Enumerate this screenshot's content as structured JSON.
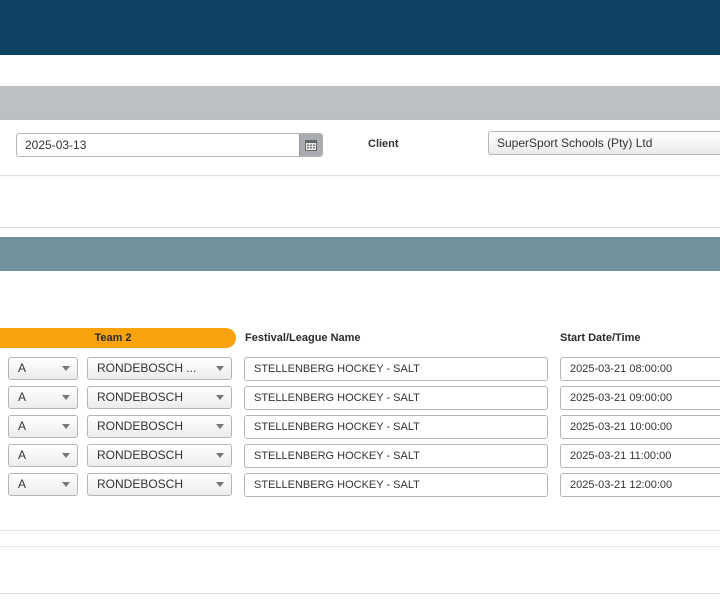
{
  "filter": {
    "date_value": "2025-03-13",
    "client_label": "Client",
    "client_value": "SuperSport Schools (Pty) Ltd"
  },
  "table": {
    "columns": {
      "team2": "Team 2",
      "festival": "Festival/League Name",
      "start": "Start Date/Time"
    },
    "rows": [
      {
        "team_letter": "A",
        "team2": "RONDEBOSCH ...",
        "festival": "STELLENBERG HOCKEY - SALT",
        "start": "2025-03-21 08:00:00"
      },
      {
        "team_letter": "A",
        "team2": "RONDEBOSCH",
        "festival": "STELLENBERG HOCKEY - SALT",
        "start": "2025-03-21 09:00:00"
      },
      {
        "team_letter": "A",
        "team2": "RONDEBOSCH",
        "festival": "STELLENBERG HOCKEY - SALT",
        "start": "2025-03-21 10:00:00"
      },
      {
        "team_letter": "A",
        "team2": "RONDEBOSCH",
        "festival": "STELLENBERG HOCKEY - SALT",
        "start": "2025-03-21 11:00:00"
      },
      {
        "team_letter": "A",
        "team2": "RONDEBOSCH",
        "festival": "STELLENBERG HOCKEY - SALT",
        "start": "2025-03-21 12:00:00"
      }
    ]
  },
  "icons": {
    "calendar": "calendar-icon",
    "dropdown": "chevron-down-icon"
  },
  "colors": {
    "topbar": "#0f4262",
    "grey_header": "#bcbfc3",
    "teal_header": "#71929c",
    "team2_header": "#f8a30e"
  }
}
